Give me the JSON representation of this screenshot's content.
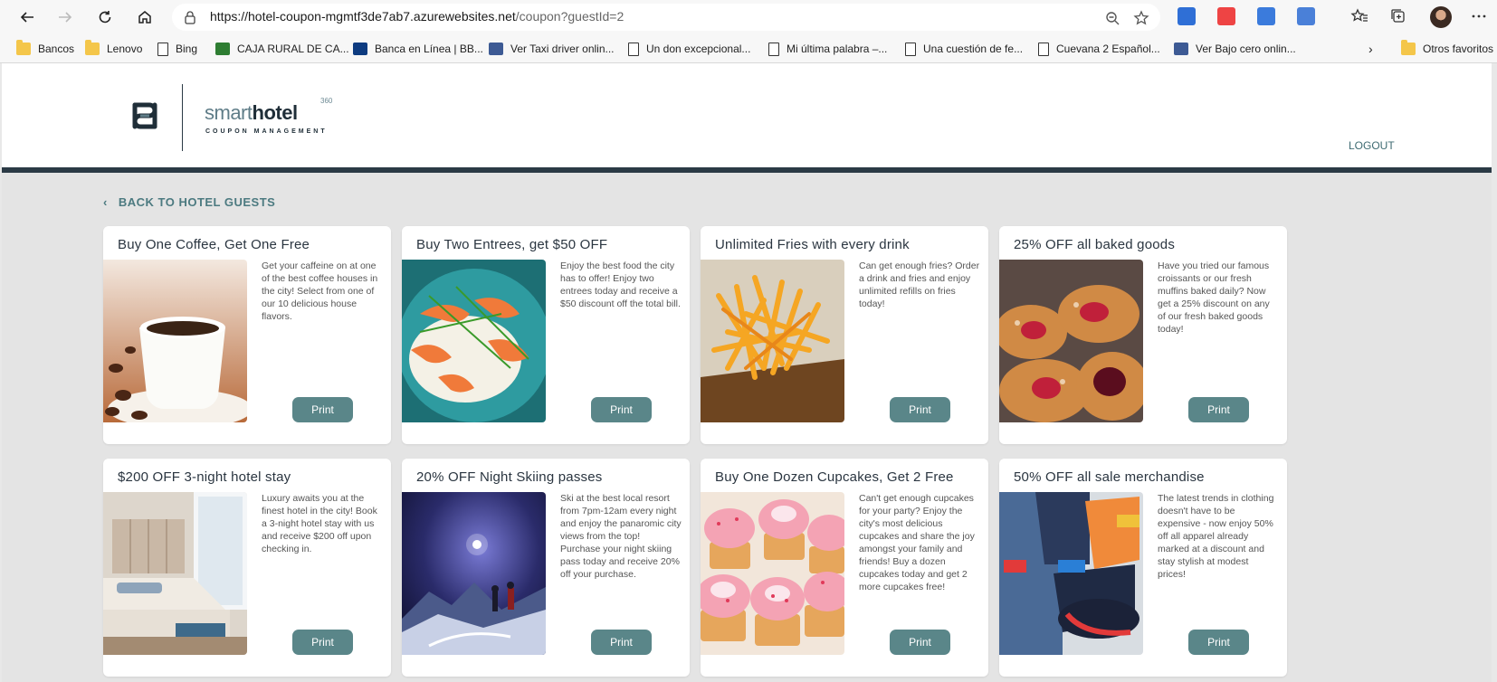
{
  "browser": {
    "url_host": "https://hotel-coupon-mgmtf3de7ab7.azurewebsites.net",
    "url_path": "/coupon?guestId=2",
    "bookmarks": [
      {
        "label": "Bancos",
        "icon": "folder-icon"
      },
      {
        "label": "Lenovo",
        "icon": "folder-icon"
      },
      {
        "label": "Bing",
        "icon": "page-icon"
      },
      {
        "label": "CAJA RURAL DE CA...",
        "icon": "bank-icon"
      },
      {
        "label": "Banca en Línea | BB...",
        "icon": "bank-icon"
      },
      {
        "label": "Ver Taxi driver onlin...",
        "icon": "video-icon"
      },
      {
        "label": "Un don excepcional...",
        "icon": "page-icon"
      },
      {
        "label": "Mi última palabra –...",
        "icon": "page-icon"
      },
      {
        "label": "Una cuestión de fe...",
        "icon": "page-icon"
      },
      {
        "label": "Cuevana 2 Español...",
        "icon": "page-icon"
      },
      {
        "label": "Ver Bajo cero onlin...",
        "icon": "video-icon"
      }
    ],
    "other_favorites": "Otros favoritos"
  },
  "header": {
    "brand_light": "smart",
    "brand_bold": "hotel",
    "brand_sup": "360",
    "brand_sub": "COUPON MANAGEMENT",
    "logout": "LOGOUT"
  },
  "back_link": "BACK TO HOTEL GUESTS",
  "coupons": [
    {
      "title": "Buy One Coffee, Get One Free",
      "desc": "Get your caffeine on at one of the best coffee houses in the city! Select from one of our 10 delicious house flavors.",
      "print": "Print",
      "image": "coffee-cup"
    },
    {
      "title": "Buy Two Entrees, get $50 OFF",
      "desc": "Enjoy the best food the city has to offer! Enjoy two entrees today and receive a $50 discount off the total bill.",
      "print": "Print",
      "image": "shrimp-dish"
    },
    {
      "title": "Unlimited Fries with every drink",
      "desc": "Can get enough fries? Order a drink and fries and enjoy unlimited refills on fries today!",
      "print": "Print",
      "image": "french-fries"
    },
    {
      "title": "25% OFF all baked goods",
      "desc": "Have you tried our famous croissants or our fresh muffins baked daily? Now get a 25% discount on any of our fresh baked goods today!",
      "print": "Print",
      "image": "pastries"
    },
    {
      "title": "$200 OFF 3-night hotel stay",
      "desc": "Luxury awaits you at the finest hotel in the city! Book a 3-night hotel stay with us and receive $200 off upon checking in.",
      "print": "Print",
      "image": "hotel-room"
    },
    {
      "title": "20% OFF Night Skiing passes",
      "desc": "Ski at the best local resort from 7pm-12am every night and enjoy the panaromic city views from the top! Purchase your night skiing pass today and receive 20% off your purchase.",
      "print": "Print",
      "image": "night-ski"
    },
    {
      "title": "Buy One Dozen Cupcakes, Get 2 Free",
      "desc": "Can't get enough cupcakes for your party? Enjoy the city's most delicious cupcakes and share the joy amongst your family and friends! Buy a dozen cupcakes today and get 2 more cupcakes free!",
      "print": "Print",
      "image": "cupcakes"
    },
    {
      "title": "50% OFF all sale merchandise",
      "desc": "The latest trends in clothing doesn't have to be expensive - now enjoy 50% off all apparel already marked at a discount and stay stylish at modest prices!",
      "print": "Print",
      "image": "sale-clothing"
    }
  ],
  "colors": {
    "accent": "#5a8689",
    "header_bar": "#2b3a45",
    "background": "#e4e4e4"
  }
}
